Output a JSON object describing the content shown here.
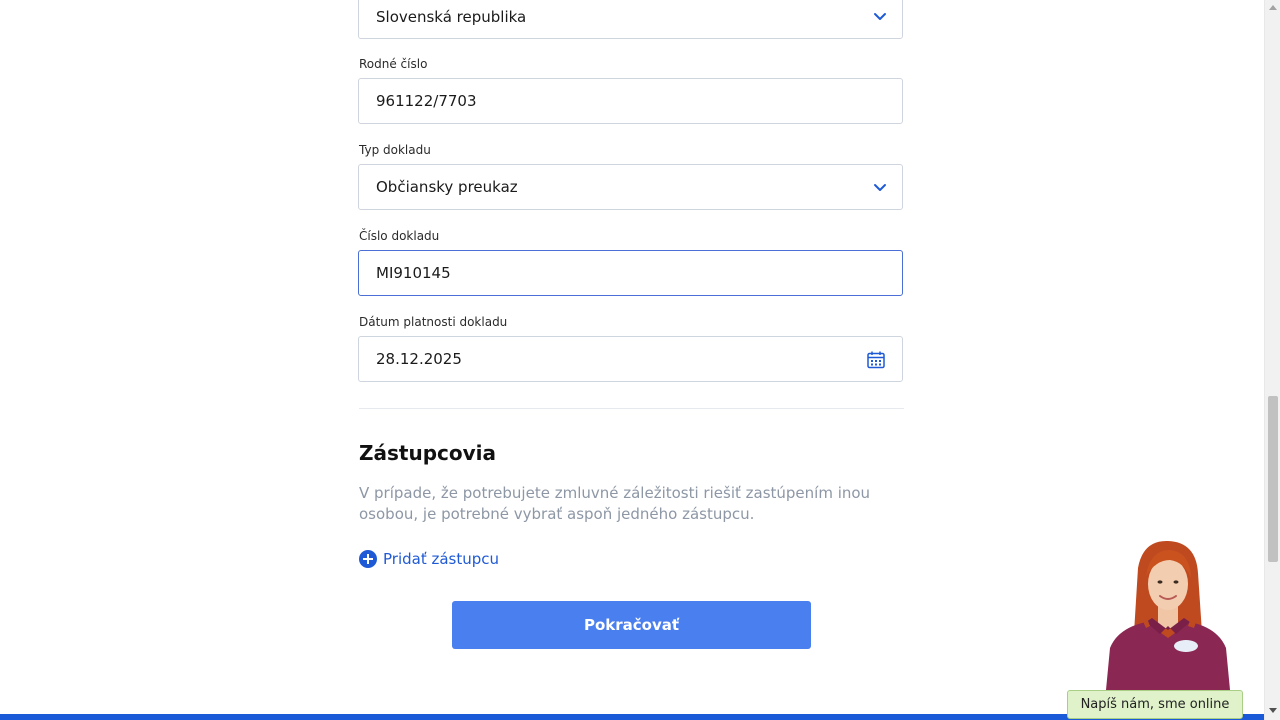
{
  "form": {
    "country": {
      "value": "Slovenská republika"
    },
    "birth_number": {
      "label": "Rodné číslo",
      "value": "961122/7703"
    },
    "document_type": {
      "label": "Typ dokladu",
      "value": "Občiansky preukaz"
    },
    "document_number": {
      "label": "Číslo dokladu",
      "value": "MI910145"
    },
    "document_validity": {
      "label": "Dátum platnosti dokladu",
      "value": "28.12.2025"
    }
  },
  "representatives": {
    "title": "Zástupcovia",
    "description": "V prípade, že potrebujete zmluvné záležitosti riešiť zastúpením inou osobou, je potrebné vybrať aspoň jedného zástupcu.",
    "add_label": "Pridať zástupcu"
  },
  "actions": {
    "continue_label": "Pokračovať"
  },
  "chat": {
    "badge_label": "Napíš nám, sme online"
  },
  "colors": {
    "accent": "#1f5ad6",
    "button": "#4a7ff0",
    "chat_badge": "#dff2c9"
  },
  "icons": {
    "dropdown": "chevron-down-icon",
    "date": "calendar-icon",
    "add": "plus-circle-icon"
  }
}
